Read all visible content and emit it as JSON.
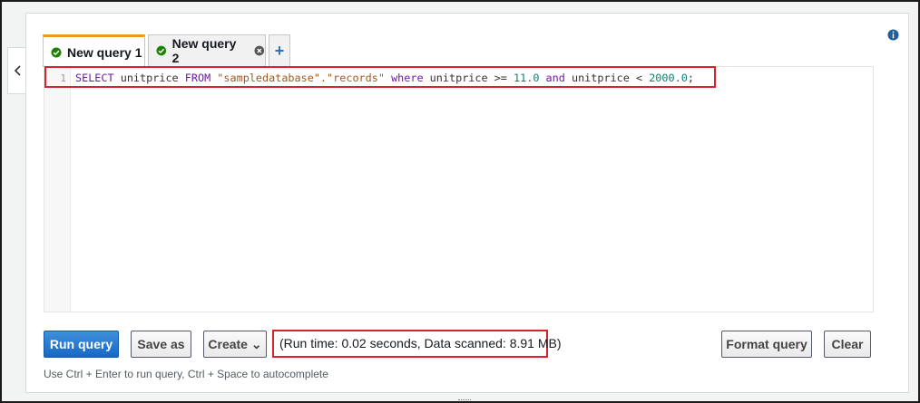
{
  "tabs": [
    {
      "label": "New query 1",
      "active": true
    },
    {
      "label": "New query 2",
      "active": false
    },
    {
      "label": "+"
    }
  ],
  "editor": {
    "line_number": "1",
    "sql_tokens": {
      "select": "SELECT",
      "column": " unitprice ",
      "from": "FROM",
      "table": " \"sampledatabase\".\"records\" ",
      "where": "where",
      "condition_column": " unitprice >= ",
      "min_value": "11.0",
      "and": " and",
      "condition_column_2": " unitprice < ",
      "max_value": "2000.0",
      "end": ";"
    }
  },
  "buttons": {
    "run_query": "Run query",
    "save_as": "Save as",
    "create": "Create ⌄",
    "format_query": "Format query",
    "clear": "Clear"
  },
  "status": {
    "run_time_text": "(Run time: 0.02 seconds, Data scanned: 8.91 MB)"
  },
  "hint": "Use Ctrl + Enter to run query, Ctrl + Space to autocomplete",
  "icons": {
    "collapse": "chevron-left-icon",
    "info": "info-icon",
    "success": "check-circle-icon",
    "close": "close-icon"
  },
  "colors": {
    "accent": "#ec9a1e",
    "primary": "#1768c6",
    "success": "#1d8102",
    "highlight": "#d8232a"
  }
}
